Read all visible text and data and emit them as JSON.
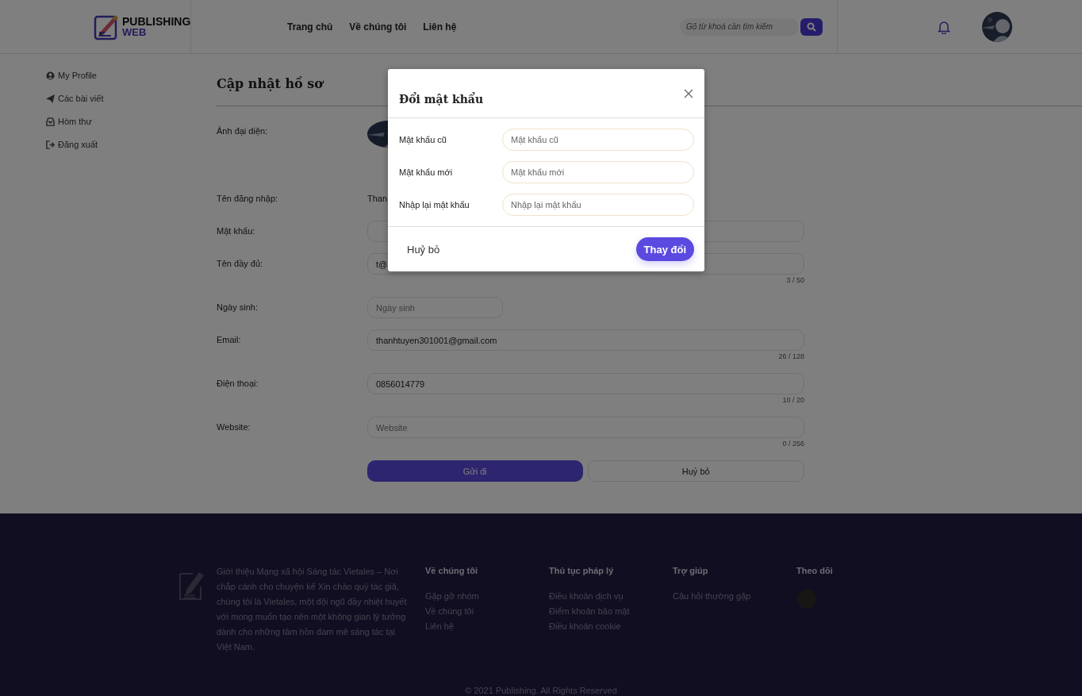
{
  "header": {
    "logo": {
      "line1": "PUBLISHING",
      "line2": "WEB"
    },
    "nav": [
      "Trang chủ",
      "Về chúng tôi",
      "Liên hệ"
    ],
    "search": {
      "placeholder": "Gõ từ khoá cần tìm kiếm"
    }
  },
  "sidebar": {
    "items": [
      {
        "label": "My Profile",
        "kind": "user"
      },
      {
        "label": "Các bài viết",
        "kind": "send"
      },
      {
        "label": "Hòm thư",
        "kind": "inbox"
      },
      {
        "label": "Đăng xuất",
        "kind": "logout"
      }
    ]
  },
  "profile": {
    "title": "Cập nhật hồ sơ",
    "rows": [
      {
        "kind": "avatar",
        "label": "Ảnh đại diện:"
      },
      {
        "kind": "text",
        "label": "Tên đăng nhập:",
        "value": "Than"
      },
      {
        "kind": "input",
        "label": "Mật khẩu:"
      },
      {
        "kind": "input",
        "label": "Tên đầy đủ:",
        "value": "t@",
        "counter": "3 / 50"
      },
      {
        "kind": "date",
        "label": "Ngày sinh:",
        "placeholder": "Ngày sinh"
      },
      {
        "kind": "input",
        "label": "Email:",
        "value": "thanhtuyen301001@gmail.com",
        "counter": "26 / 128"
      },
      {
        "kind": "input",
        "label": "Điện thoại:",
        "value": "0856014779",
        "counter": "10 / 20"
      },
      {
        "kind": "input",
        "label": "Website:",
        "placeholder": "Website",
        "counter": "0 / 256"
      }
    ],
    "submit": "Gửi đi",
    "cancel": "Huỷ bỏ"
  },
  "modal": {
    "title": "Đổi mật khẩu",
    "fields": [
      {
        "label": "Mật khẩu cũ",
        "placeholder": "Mật khẩu cũ"
      },
      {
        "label": "Mật khẩu mới",
        "placeholder": "Mật khẩu mới"
      },
      {
        "label": "Nhập lại mật khẩu",
        "placeholder": "Nhập lại mật khẩu"
      }
    ],
    "cancel": "Huỷ bỏ",
    "confirm": "Thay đổi"
  },
  "footer": {
    "about": "Giới thiệu Mạng xã hội Sáng tác Vietales – Nơi chắp cánh cho chuyện kể Xin chào quý tác giả, chúng tôi là Vietales, một đội ngũ đầy nhiệt huyết với mong muốn tạo nên một không gian lý tưởng dành cho những tâm hồn đam mê sáng tác tại Việt Nam.",
    "columns": [
      {
        "heading": "Về chúng tôi",
        "links": [
          "Gặp gỡ nhóm",
          "Về chúng tôi",
          "Liên hệ"
        ]
      },
      {
        "heading": "Thủ tục pháp lý",
        "links": [
          "Điều khoản dịch vụ",
          "Điểm khoản bảo mật",
          "Điều khoản cookie"
        ]
      },
      {
        "heading": "Trợ giúp",
        "links": [
          "Câu hỏi thường gặp"
        ]
      }
    ],
    "follow": "Theo dõi",
    "copyright": "© 2021 Publishing. All Rights Reserved"
  }
}
